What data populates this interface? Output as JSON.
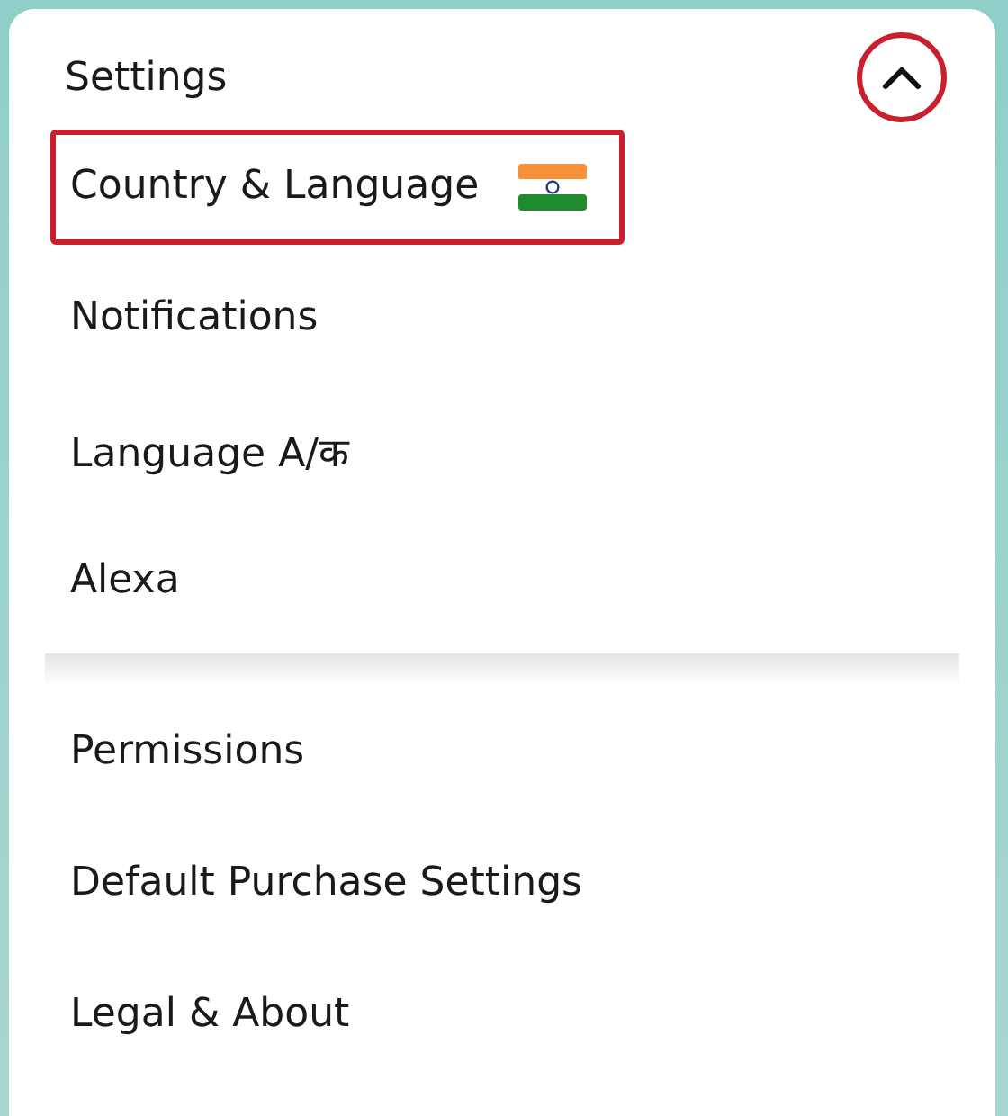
{
  "header": {
    "title": "Settings",
    "expanded": true,
    "highlighted": true
  },
  "groups": [
    [
      {
        "label": "Country & Language",
        "kind": "flag",
        "highlighted": true
      },
      {
        "label": "Notifications",
        "kind": "plain",
        "highlighted": false
      },
      {
        "label": "Language A/क",
        "kind": "plain",
        "highlighted": false
      },
      {
        "label": "Alexa",
        "kind": "plain",
        "highlighted": false
      }
    ],
    [
      {
        "label": "Permissions",
        "kind": "plain",
        "highlighted": false
      },
      {
        "label": "Default Purchase Settings",
        "kind": "plain",
        "highlighted": false
      },
      {
        "label": "Legal & About",
        "kind": "plain",
        "highlighted": false
      }
    ]
  ]
}
